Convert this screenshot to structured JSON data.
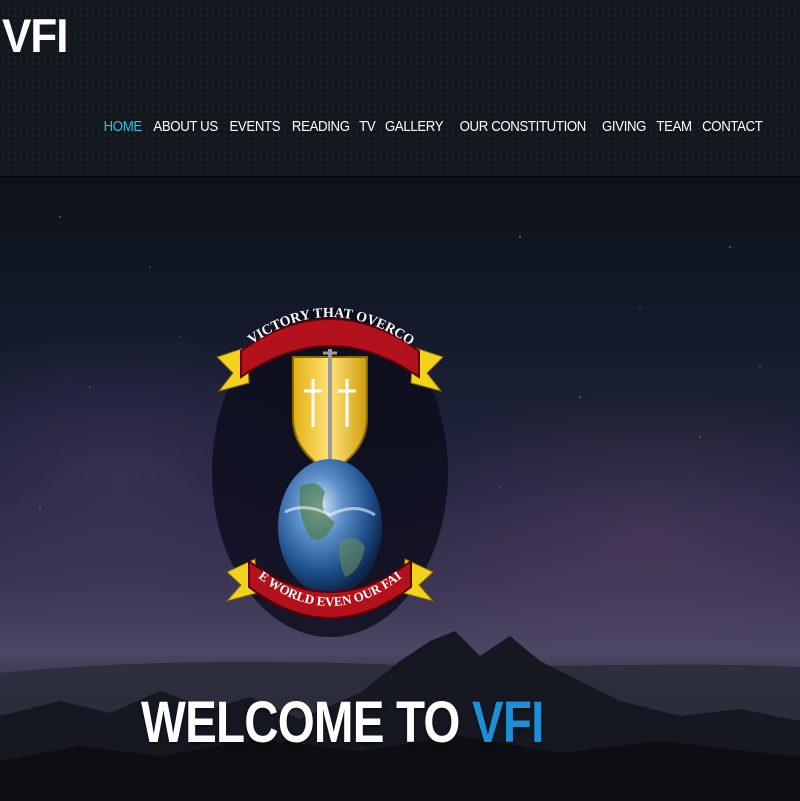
{
  "site": {
    "logo_text": "VFI"
  },
  "nav": {
    "items": [
      {
        "label": "HOME",
        "active": true
      },
      {
        "label": "ABOUT US",
        "active": false
      },
      {
        "label": "EVENTS",
        "active": false
      },
      {
        "label": "READING",
        "active": false
      },
      {
        "label": "TV",
        "active": false
      },
      {
        "label": "GALLERY",
        "active": false
      },
      {
        "label": "OUR CONSTITUTION",
        "active": false
      },
      {
        "label": "GIVING",
        "active": false
      },
      {
        "label": "TEAM",
        "active": false
      },
      {
        "label": "CONTACT",
        "active": false
      }
    ]
  },
  "hero": {
    "emblem": {
      "top_banner": "THE VICTORY THAT OVERCOMES",
      "bottom_banner": "THE WORLD EVEN OUR FAITH"
    },
    "welcome_prefix": "WELCOME TO",
    "welcome_highlight": "VFI"
  },
  "colors": {
    "accent_active_nav": "#2ac1e8",
    "accent_highlight": "#1d8fd6",
    "banner_red": "#b3121c",
    "banner_gold": "#f2d21b"
  }
}
